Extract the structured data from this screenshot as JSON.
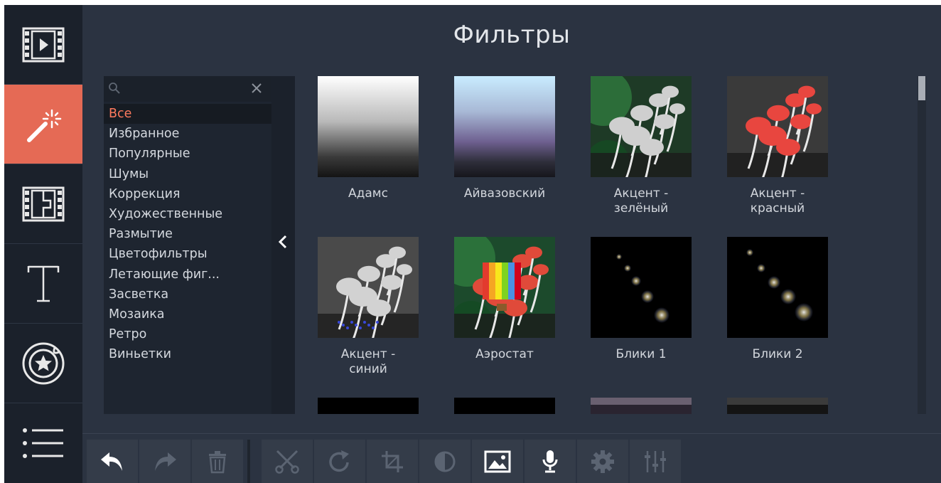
{
  "panel": {
    "title": "Фильтры"
  },
  "search": {
    "placeholder": "",
    "value": ""
  },
  "categories": [
    {
      "label": "Все",
      "selected": true
    },
    {
      "label": "Избранное"
    },
    {
      "label": "Популярные"
    },
    {
      "label": "Шумы"
    },
    {
      "label": "Коррекция"
    },
    {
      "label": "Художественные"
    },
    {
      "label": "Размытие"
    },
    {
      "label": "Цветофильтры"
    },
    {
      "label": "Летающие фиг..."
    },
    {
      "label": "Засветка"
    },
    {
      "label": "Мозаика"
    },
    {
      "label": "Ретро"
    },
    {
      "label": "Виньетки"
    }
  ],
  "filters": [
    {
      "label": "Адамс",
      "thumb": "gradient-grey"
    },
    {
      "label": "Айвазовский",
      "thumb": "gradient-blue-purple"
    },
    {
      "label": "Акцент -\nзелёный",
      "thumb": "mushrooms-green-accent"
    },
    {
      "label": "Акцент -\nкрасный",
      "thumb": "mushrooms-red-accent"
    },
    {
      "label": "Акцент -\nсиний",
      "thumb": "mushrooms-blue-accent"
    },
    {
      "label": "Аэростат",
      "thumb": "mushrooms-balloon"
    },
    {
      "label": "Блики 1",
      "thumb": "bokeh-1"
    },
    {
      "label": "Блики 2",
      "thumb": "bokeh-2"
    }
  ],
  "left_toolbar": [
    {
      "name": "media-import",
      "icon": "film-play-icon"
    },
    {
      "name": "filters",
      "icon": "magic-wand-icon",
      "active": true
    },
    {
      "name": "transitions",
      "icon": "film-transition-icon"
    },
    {
      "name": "titles",
      "icon": "text-T-icon"
    },
    {
      "name": "stickers",
      "icon": "sticker-star-icon"
    },
    {
      "name": "more",
      "icon": "list-menu-icon"
    }
  ],
  "bottom_toolbar": [
    {
      "name": "undo",
      "icon": "undo-icon"
    },
    {
      "name": "redo",
      "icon": "redo-icon"
    },
    {
      "name": "delete",
      "icon": "trash-icon"
    },
    {
      "name": "cut",
      "icon": "scissors-icon"
    },
    {
      "name": "rotate",
      "icon": "rotate-icon"
    },
    {
      "name": "crop",
      "icon": "crop-icon"
    },
    {
      "name": "color-adjust",
      "icon": "contrast-icon"
    },
    {
      "name": "image",
      "icon": "image-icon"
    },
    {
      "name": "record-audio",
      "icon": "microphone-icon"
    },
    {
      "name": "clip-properties",
      "icon": "gear-icon"
    },
    {
      "name": "equalizer",
      "icon": "equalizer-icon"
    }
  ],
  "colors": {
    "accent": "#e56a55",
    "selected_text": "#ff7a5e",
    "background": "#2b3341"
  }
}
